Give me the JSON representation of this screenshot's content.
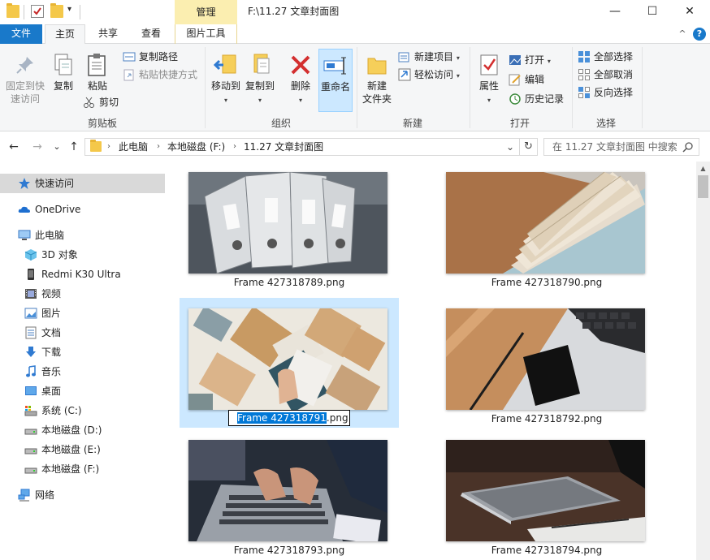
{
  "window": {
    "title": "F:\\11.27 文章封面图",
    "minimize": "—",
    "maximize": "☐",
    "close": "✕"
  },
  "quick_access_toolbar": {
    "dropdown": "▾"
  },
  "ribbon_tabs": {
    "contextual_group": "管理",
    "file": "文件",
    "home": "主页",
    "share": "共享",
    "view": "查看",
    "picture_tools": "图片工具",
    "collapse": "^",
    "help": "?"
  },
  "ribbon": {
    "clipboard": {
      "label": "剪贴板",
      "pin_quick_access_line1": "固定到快",
      "pin_quick_access_line2": "速访问",
      "copy": "复制",
      "paste": "粘贴",
      "copy_path": "复制路径",
      "paste_shortcut": "粘贴快捷方式",
      "cut": "剪切"
    },
    "organize": {
      "label": "组织",
      "move_to": "移动到",
      "copy_to": "复制到",
      "delete": "删除",
      "rename": "重命名"
    },
    "new": {
      "label": "新建",
      "new_folder_line1": "新建",
      "new_folder_line2": "文件夹",
      "new_item": "新建项目",
      "easy_access": "轻松访问"
    },
    "open": {
      "label": "打开",
      "properties": "属性",
      "open": "打开",
      "edit": "编辑",
      "history": "历史记录"
    },
    "select": {
      "label": "选择",
      "select_all": "全部选择",
      "select_none": "全部取消",
      "invert_selection": "反向选择"
    }
  },
  "address_bar": {
    "back": "←",
    "forward": "→",
    "recent": "⌄",
    "up": "↑",
    "breadcrumbs": [
      "此电脑",
      "本地磁盘 (F:)",
      "11.27 文章封面图"
    ],
    "dropdown": "⌄",
    "refresh": "↻",
    "search_placeholder": "在 11.27 文章封面图 中搜索"
  },
  "nav_pane": {
    "items": [
      {
        "label": "快速访问",
        "icon": "star-icon"
      },
      {
        "label": "OneDrive",
        "icon": "cloud-icon"
      },
      {
        "label": "此电脑",
        "icon": "computer-icon"
      },
      {
        "label": "3D 对象",
        "icon": "cube-icon"
      },
      {
        "label": "Redmi K30 Ultra",
        "icon": "phone-icon"
      },
      {
        "label": "视频",
        "icon": "video-icon"
      },
      {
        "label": "图片",
        "icon": "pictures-icon"
      },
      {
        "label": "文档",
        "icon": "documents-icon"
      },
      {
        "label": "下载",
        "icon": "download-icon"
      },
      {
        "label": "音乐",
        "icon": "music-icon"
      },
      {
        "label": "桌面",
        "icon": "desktop-icon"
      },
      {
        "label": "系统 (C:)",
        "icon": "system-drive-icon"
      },
      {
        "label": "本地磁盘 (D:)",
        "icon": "drive-icon"
      },
      {
        "label": "本地磁盘 (E:)",
        "icon": "drive-icon"
      },
      {
        "label": "本地磁盘 (F:)",
        "icon": "drive-icon"
      },
      {
        "label": "网络",
        "icon": "network-icon"
      }
    ]
  },
  "files": [
    {
      "name": "Frame 427318789.png"
    },
    {
      "name": "Frame 427318790.png"
    },
    {
      "name": "Frame 427318791.png",
      "rename_selected": "Frame 427318791",
      "rename_rest": ".png"
    },
    {
      "name": "Frame 427318792.png"
    },
    {
      "name": "Frame 427318793.png"
    },
    {
      "name": "Frame 427318794.png"
    }
  ],
  "colors": {
    "file_tab": "#1979ca",
    "contextual_tab": "#fbeeb0",
    "selection": "#cce8ff",
    "rename_highlight": "#0078d7"
  }
}
